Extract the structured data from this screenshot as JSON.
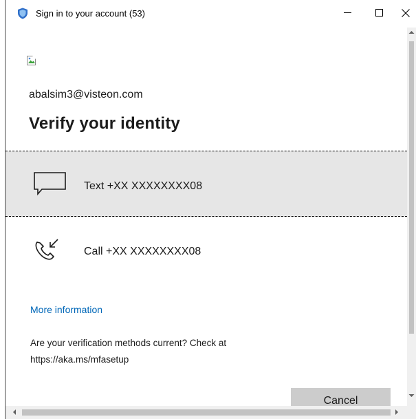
{
  "window": {
    "title": "Sign in to your account (53)",
    "icons": {
      "app": "shield-icon",
      "minimize": "minimize-icon",
      "maximize": "maximize-icon",
      "close": "close-icon"
    }
  },
  "account": {
    "email": "abalsim3@visteon.com"
  },
  "page": {
    "heading": "Verify your identity"
  },
  "options": [
    {
      "icon": "sms-chat-icon",
      "label": "Text +XX XXXXXXXX08"
    },
    {
      "icon": "phone-call-icon",
      "label": "Call +XX XXXXXXXX08"
    }
  ],
  "links": {
    "more_info": "More information"
  },
  "note": {
    "line1": "Are your verification methods current? Check at",
    "line2": "https://aka.ms/mfasetup"
  },
  "buttons": {
    "cancel": "Cancel"
  },
  "colors": {
    "link": "#0067b8",
    "selected_option_bg": "#e6e6e6",
    "button_bg": "#cccccc"
  }
}
